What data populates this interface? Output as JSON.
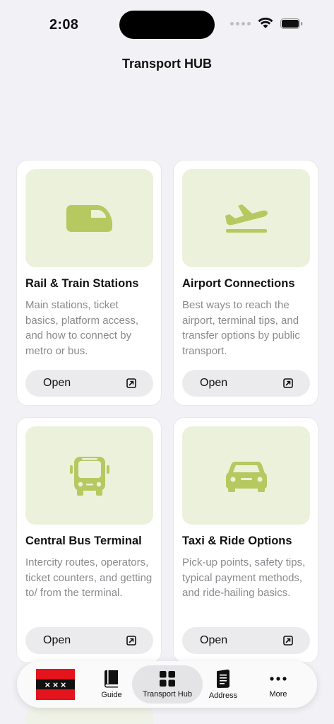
{
  "status": {
    "time": "2:08"
  },
  "nav": {
    "title": "Transport HUB"
  },
  "cards": [
    {
      "title": "Rail & Train Stations",
      "description": "Main stations, ticket basics, platform access, and how to connect by metro or bus.",
      "button": "Open",
      "icon": "train-icon"
    },
    {
      "title": "Airport Connections",
      "description": "Best ways to reach the airport, terminal tips, and transfer options by public transport.",
      "button": "Open",
      "icon": "airplane-departure-icon"
    },
    {
      "title": "Central Bus Terminal",
      "description": "Intercity routes, operators, ticket counters, and getting to/ from the terminal.",
      "button": "Open",
      "icon": "bus-icon"
    },
    {
      "title": "Taxi & Ride Options",
      "description": "Pick-up points, safety tips, typical payment methods, and ride-hailing basics.",
      "button": "Open",
      "icon": "car-icon"
    }
  ],
  "tabs": [
    {
      "label": "Guide",
      "icon": "book-icon"
    },
    {
      "label": "Transport Hub",
      "icon": "grid-icon",
      "active": true
    },
    {
      "label": "Address",
      "icon": "address-book-icon"
    },
    {
      "label": "More",
      "icon": "ellipsis-icon"
    }
  ],
  "flag": {
    "symbols": "× × ×"
  },
  "colors": {
    "accent": "#b5c960",
    "media_bg": "#ecf1dc",
    "flag_red": "#e3141b"
  }
}
